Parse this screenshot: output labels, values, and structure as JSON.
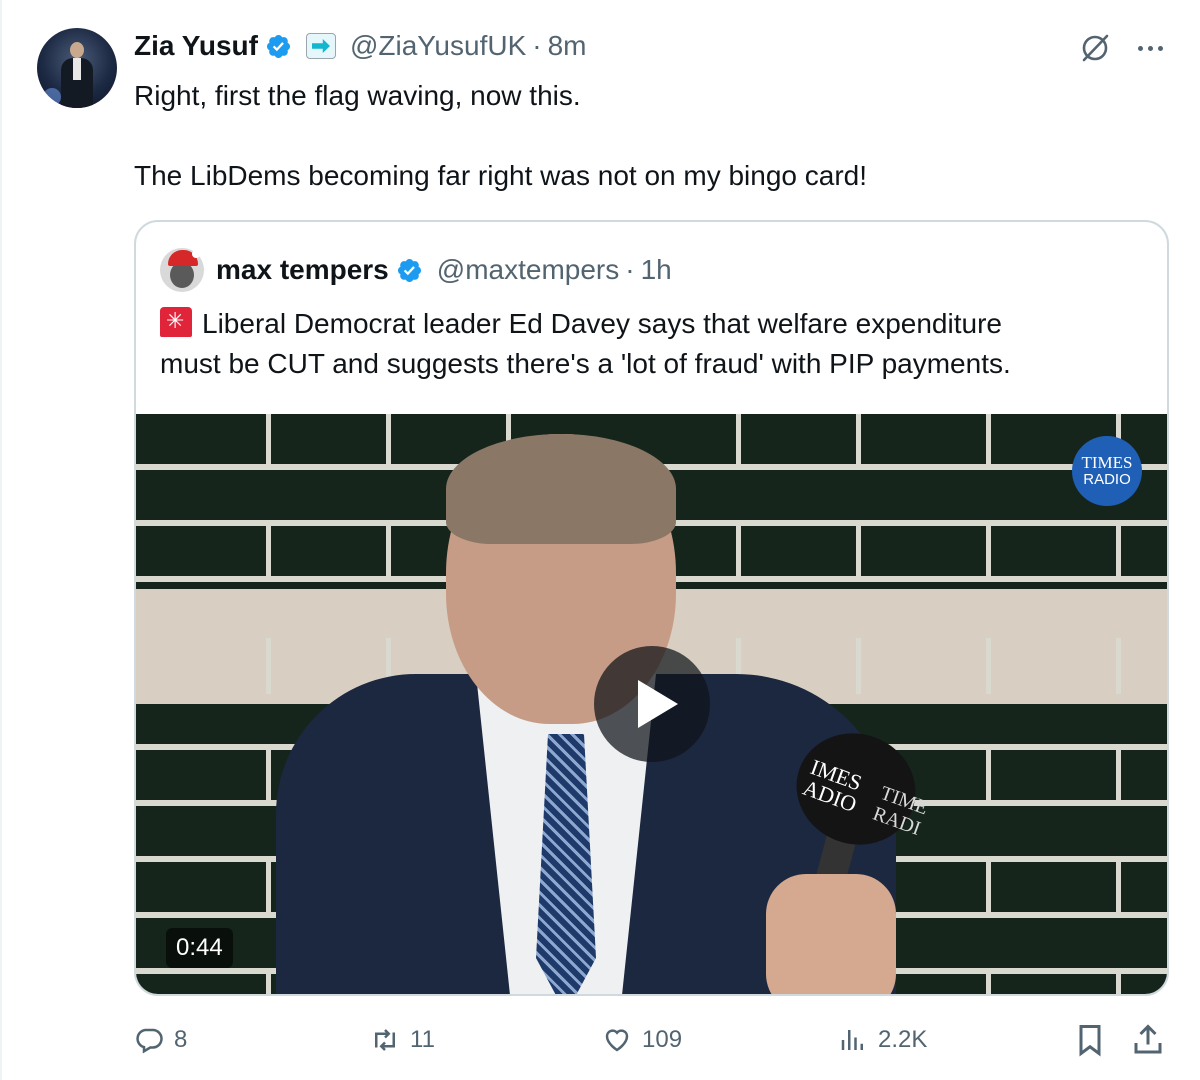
{
  "tweet": {
    "author_name": "Zia Yusuf",
    "author_handle": "@ZiaYusufUK",
    "separator": "·",
    "time": "8m",
    "text_line1": "Right, first the flag waving, now this.",
    "text_line2": "The LibDems becoming far right was not on my bingo card!"
  },
  "quote": {
    "author_name": "max tempers",
    "author_handle": "@maxtempers",
    "separator": "·",
    "time": "1h",
    "text_line1": "Liberal Democrat leader Ed Davey says that welfare expenditure",
    "text_line2": "must be CUT and suggests there's a 'lot of fraud' with PIP payments.",
    "video": {
      "duration": "0:44",
      "badge_line1": "TIMES",
      "badge_line2": "RADIO",
      "mic_text1": "IMES",
      "mic_text1b": "ADIO",
      "mic_text2": "TIME",
      "mic_text2b": "RADI"
    }
  },
  "actions": {
    "replies": "8",
    "reposts": "11",
    "likes": "109",
    "views": "2.2K"
  },
  "colors": {
    "verified": "#1d9bf0",
    "secondary_text": "#536471",
    "border": "#cfd9de",
    "badge": "#1f5fb6"
  },
  "icons": [
    "verified-badge-icon",
    "affiliate-badge-icon",
    "grok-icon",
    "more-icon",
    "siren-icon",
    "play-icon",
    "reply-icon",
    "repost-icon",
    "like-icon",
    "views-icon",
    "bookmark-icon",
    "share-icon"
  ]
}
